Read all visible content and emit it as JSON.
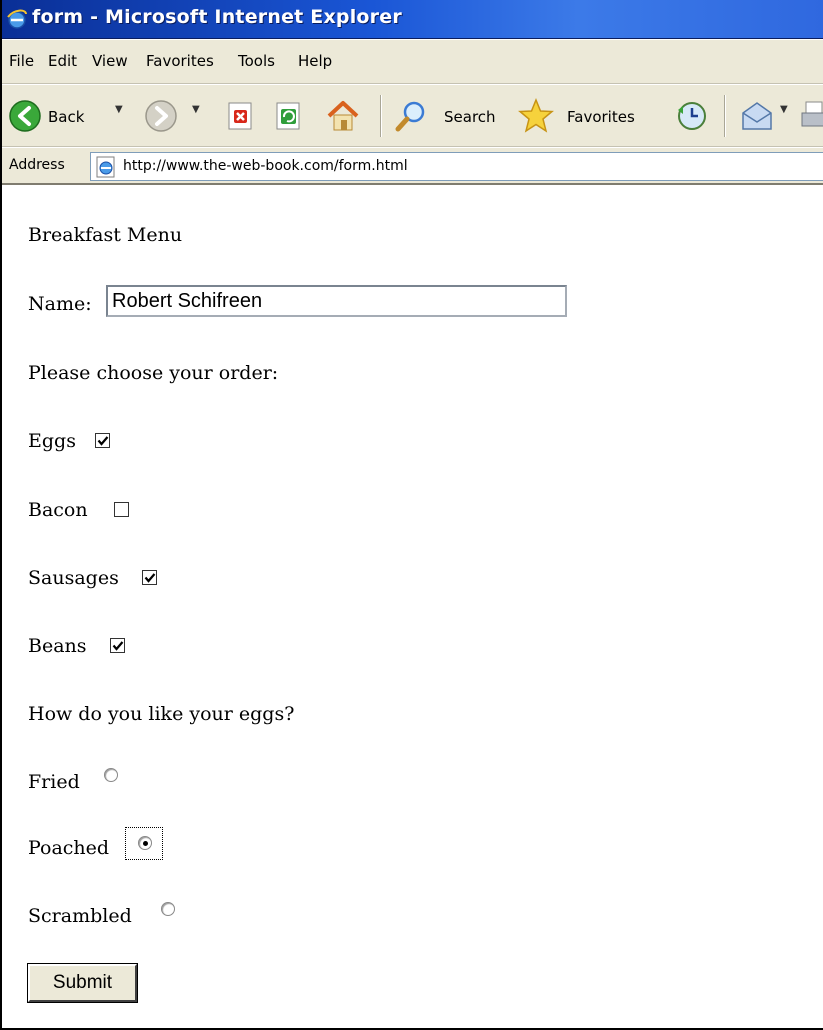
{
  "window": {
    "title": "form - Microsoft Internet Explorer"
  },
  "menu": [
    "File",
    "Edit",
    "View",
    "Favorites",
    "Tools",
    "Help"
  ],
  "toolbar": {
    "back_label": "Back",
    "search_label": "Search",
    "favorites_label": "Favorites"
  },
  "address": {
    "label": "Address",
    "url": "http://www.the-web-book.com/form.html"
  },
  "form": {
    "heading": "Breakfast Menu",
    "name_label": "Name:",
    "name_value": "Robert Schifreen",
    "order_prompt": "Please choose your order:",
    "items": [
      {
        "label": "Eggs",
        "checked": true
      },
      {
        "label": "Bacon",
        "checked": false
      },
      {
        "label": "Sausages",
        "checked": true
      },
      {
        "label": "Beans",
        "checked": true
      }
    ],
    "eggs_prompt": "How do you like your eggs?",
    "egg_styles": [
      {
        "label": "Fried",
        "selected": false
      },
      {
        "label": "Poached",
        "selected": true
      },
      {
        "label": "Scrambled",
        "selected": false
      }
    ],
    "submit_label": "Submit"
  }
}
